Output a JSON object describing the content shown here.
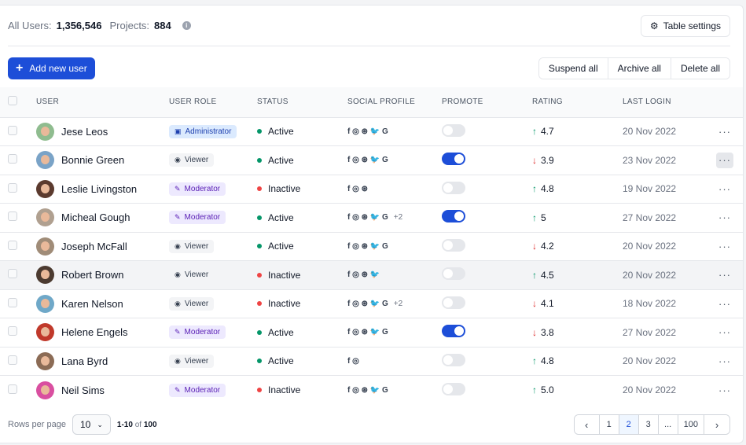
{
  "header": {
    "all_users_label": "All Users:",
    "all_users_value": "1,356,546",
    "projects_label": "Projects:",
    "projects_value": "884",
    "info_icon": "i",
    "table_settings_label": "Table settings"
  },
  "actions": {
    "add_user_label": "Add new user",
    "suspend_label": "Suspend all",
    "archive_label": "Archive all",
    "delete_label": "Delete all"
  },
  "columns": [
    "USER",
    "USER ROLE",
    "STATUS",
    "SOCIAL PROFILE",
    "PROMOTE",
    "RATING",
    "LAST LOGIN"
  ],
  "rows": [
    {
      "name": "Jese Leos",
      "role": "Administrator",
      "role_type": "admin",
      "status": "Active",
      "status_color": "#059669",
      "social": "f ◎ ⊛ 🐦 G",
      "social_more": "",
      "promote": false,
      "trend": "↑",
      "trend_type": "up",
      "rating": "4.7",
      "last_login": "20 Nov 2022",
      "avatar_color": "#8fbc8f"
    },
    {
      "name": "Bonnie Green",
      "role": "Viewer",
      "role_type": "viewer",
      "status": "Active",
      "status_color": "#059669",
      "social": "f ◎ ⊛ 🐦 G",
      "social_more": "",
      "promote": true,
      "trend": "↓",
      "trend_type": "down",
      "rating": "3.9",
      "last_login": "23 Nov 2022",
      "avatar_color": "#7aa3c7"
    },
    {
      "name": "Leslie Livingston",
      "role": "Moderator",
      "role_type": "mod",
      "status": "Inactive",
      "status_color": "#ef4444",
      "social": "f ◎ ⊛",
      "social_more": "",
      "promote": false,
      "trend": "↑",
      "trend_type": "up",
      "rating": "4.8",
      "last_login": "19 Nov 2022",
      "avatar_color": "#5b3a2e"
    },
    {
      "name": "Micheal Gough",
      "role": "Moderator",
      "role_type": "mod",
      "status": "Active",
      "status_color": "#059669",
      "social": "f ◎ ⊛ 🐦 G",
      "social_more": "+2",
      "promote": true,
      "trend": "↑",
      "trend_type": "up",
      "rating": "5",
      "last_login": "27 Nov 2022",
      "avatar_color": "#b0a090"
    },
    {
      "name": "Joseph McFall",
      "role": "Viewer",
      "role_type": "viewer",
      "status": "Active",
      "status_color": "#059669",
      "social": "f ◎ ⊛ 🐦 G",
      "social_more": "",
      "promote": false,
      "trend": "↓",
      "trend_type": "down",
      "rating": "4.2",
      "last_login": "20 Nov 2022",
      "avatar_color": "#a08c78"
    },
    {
      "name": "Robert Brown",
      "role": "Viewer",
      "role_type": "viewer",
      "status": "Inactive",
      "status_color": "#ef4444",
      "social": "f ◎ ⊛ 🐦",
      "social_more": "",
      "promote": false,
      "trend": "↑",
      "trend_type": "up",
      "rating": "4.5",
      "last_login": "20 Nov 2022",
      "avatar_color": "#4b3a30"
    },
    {
      "name": "Karen Nelson",
      "role": "Viewer",
      "role_type": "viewer",
      "status": "Inactive",
      "status_color": "#ef4444",
      "social": "f ◎ ⊛ 🐦 G",
      "social_more": "+2",
      "promote": false,
      "trend": "↓",
      "trend_type": "down",
      "rating": "4.1",
      "last_login": "18 Nov 2022",
      "avatar_color": "#6fa8c8"
    },
    {
      "name": "Helene Engels",
      "role": "Moderator",
      "role_type": "mod",
      "status": "Active",
      "status_color": "#059669",
      "social": "f ◎ ⊛ 🐦 G",
      "social_more": "",
      "promote": true,
      "trend": "↓",
      "trend_type": "down",
      "rating": "3.8",
      "last_login": "27 Nov 2022",
      "avatar_color": "#c0392b"
    },
    {
      "name": "Lana Byrd",
      "role": "Viewer",
      "role_type": "viewer",
      "status": "Active",
      "status_color": "#059669",
      "social": "f ◎",
      "social_more": "",
      "promote": false,
      "trend": "↑",
      "trend_type": "up",
      "rating": "4.8",
      "last_login": "20 Nov 2022",
      "avatar_color": "#8b6b55"
    },
    {
      "name": "Neil Sims",
      "role": "Moderator",
      "role_type": "mod",
      "status": "Inactive",
      "status_color": "#ef4444",
      "social": "f ◎ ⊛ 🐦 G",
      "social_more": "",
      "promote": false,
      "trend": "↑",
      "trend_type": "up",
      "rating": "5.0",
      "last_login": "20 Nov 2022",
      "avatar_color": "#d94fa0"
    }
  ],
  "highlighted_row": 5,
  "active_menu_row": 1,
  "footer": {
    "rows_per_page_label": "Rows per page",
    "rows_per_page_value": "10",
    "range_text": "1-10",
    "range_of": "of",
    "range_total": "100",
    "pages": [
      "1",
      "2",
      "3",
      "...",
      "100"
    ],
    "current_page": "2",
    "prev_icon": "‹",
    "next_icon": "›"
  },
  "colors": {
    "primary": "#1d4ed8",
    "active": "#059669",
    "inactive": "#ef4444"
  },
  "icons": {
    "settings": "gear-icon",
    "add": "plus-icon",
    "chevron": "chevron-down-icon"
  }
}
